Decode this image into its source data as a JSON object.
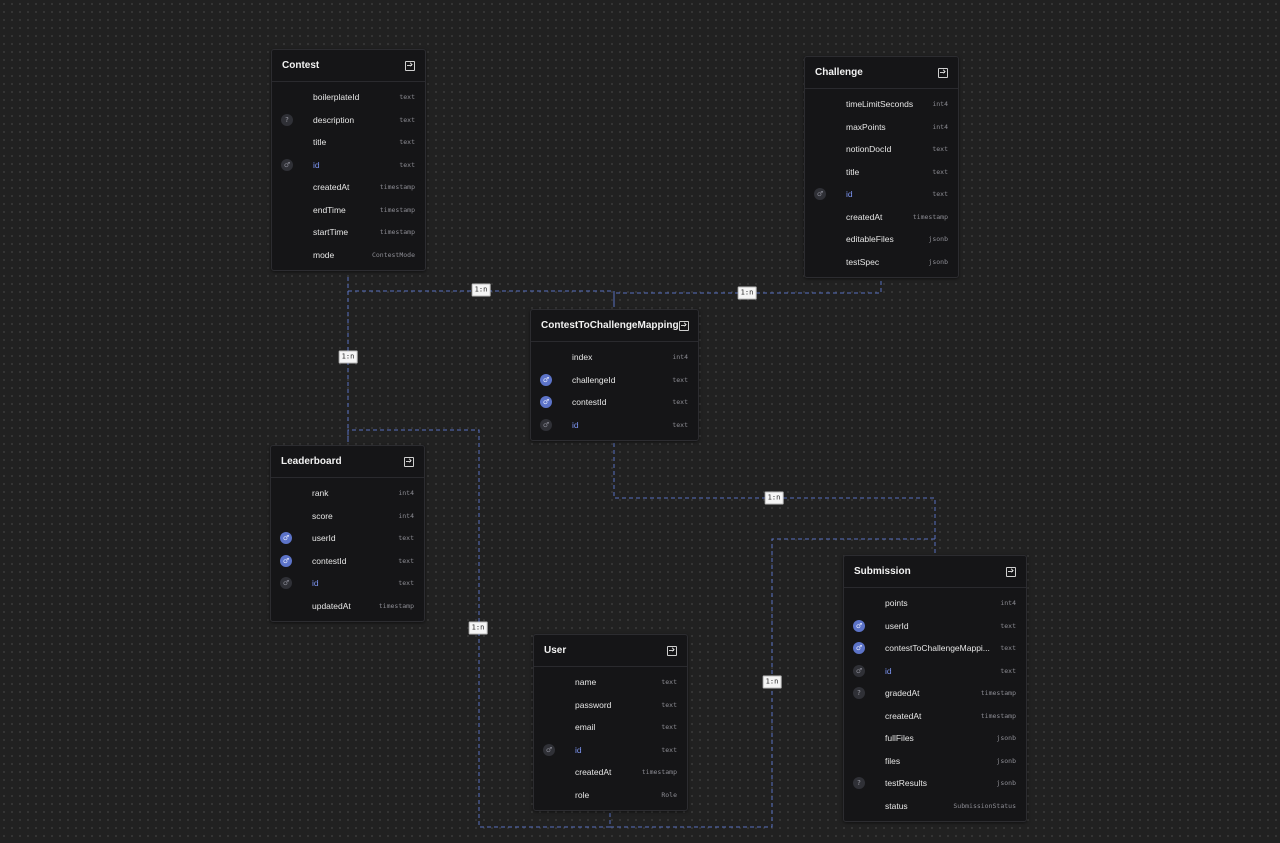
{
  "canvas": {
    "background": "#212121",
    "grid": "dotted"
  },
  "colors": {
    "edge": "#5670c0",
    "fk_badge": "#5c73c8",
    "pk_text": "#7b93f0"
  },
  "tables": [
    {
      "name": "Contest",
      "columns": [
        {
          "name": "boilerplateId",
          "type": "text",
          "badge": "none"
        },
        {
          "name": "description",
          "type": "text",
          "badge": "nullable"
        },
        {
          "name": "title",
          "type": "text",
          "badge": "none"
        },
        {
          "name": "id",
          "type": "text",
          "badge": "pk"
        },
        {
          "name": "createdAt",
          "type": "timestamp",
          "badge": "none"
        },
        {
          "name": "endTime",
          "type": "timestamp",
          "badge": "none"
        },
        {
          "name": "startTime",
          "type": "timestamp",
          "badge": "none"
        },
        {
          "name": "mode",
          "type": "ContestMode",
          "badge": "none"
        }
      ]
    },
    {
      "name": "Challenge",
      "columns": [
        {
          "name": "timeLimitSeconds",
          "type": "int4",
          "badge": "none"
        },
        {
          "name": "maxPoints",
          "type": "int4",
          "badge": "none"
        },
        {
          "name": "notionDocId",
          "type": "text",
          "badge": "none"
        },
        {
          "name": "title",
          "type": "text",
          "badge": "none"
        },
        {
          "name": "id",
          "type": "text",
          "badge": "pk"
        },
        {
          "name": "createdAt",
          "type": "timestamp",
          "badge": "none"
        },
        {
          "name": "editableFiles",
          "type": "jsonb",
          "badge": "none"
        },
        {
          "name": "testSpec",
          "type": "jsonb",
          "badge": "none"
        }
      ]
    },
    {
      "name": "ContestToChallengeMapping",
      "columns": [
        {
          "name": "index",
          "type": "int4",
          "badge": "none"
        },
        {
          "name": "challengeId",
          "type": "text",
          "badge": "fk"
        },
        {
          "name": "contestId",
          "type": "text",
          "badge": "fk"
        },
        {
          "name": "id",
          "type": "text",
          "badge": "pk"
        }
      ]
    },
    {
      "name": "Leaderboard",
      "columns": [
        {
          "name": "rank",
          "type": "int4",
          "badge": "none"
        },
        {
          "name": "score",
          "type": "int4",
          "badge": "none"
        },
        {
          "name": "userId",
          "type": "text",
          "badge": "fk"
        },
        {
          "name": "contestId",
          "type": "text",
          "badge": "fk"
        },
        {
          "name": "id",
          "type": "text",
          "badge": "pk"
        },
        {
          "name": "updatedAt",
          "type": "timestamp",
          "badge": "none"
        }
      ]
    },
    {
      "name": "User",
      "columns": [
        {
          "name": "name",
          "type": "text",
          "badge": "none"
        },
        {
          "name": "password",
          "type": "text",
          "badge": "none"
        },
        {
          "name": "email",
          "type": "text",
          "badge": "none"
        },
        {
          "name": "id",
          "type": "text",
          "badge": "pk"
        },
        {
          "name": "createdAt",
          "type": "timestamp",
          "badge": "none"
        },
        {
          "name": "role",
          "type": "Role",
          "badge": "none"
        }
      ]
    },
    {
      "name": "Submission",
      "columns": [
        {
          "name": "points",
          "type": "int4",
          "badge": "none"
        },
        {
          "name": "userId",
          "type": "text",
          "badge": "fk"
        },
        {
          "name": "contestToChallengeMappi...",
          "type": "text",
          "badge": "fk"
        },
        {
          "name": "id",
          "type": "text",
          "badge": "pk"
        },
        {
          "name": "gradedAt",
          "type": "timestamp",
          "badge": "nullable"
        },
        {
          "name": "createdAt",
          "type": "timestamp",
          "badge": "none"
        },
        {
          "name": "fullFiles",
          "type": "jsonb",
          "badge": "none"
        },
        {
          "name": "files",
          "type": "jsonb",
          "badge": "none"
        },
        {
          "name": "testResults",
          "type": "jsonb",
          "badge": "nullable"
        },
        {
          "name": "status",
          "type": "SubmissionStatus",
          "badge": "none"
        }
      ]
    }
  ],
  "relations": [
    {
      "from": "Contest",
      "to": "ContestToChallengeMapping",
      "label": "1:n"
    },
    {
      "from": "Challenge",
      "to": "ContestToChallengeMapping",
      "label": "1:n"
    },
    {
      "from": "Contest",
      "to": "Leaderboard",
      "label": "1:n"
    },
    {
      "from": "User",
      "to": "Leaderboard",
      "label": "1:n"
    },
    {
      "from": "ContestToChallengeMapping",
      "to": "Submission",
      "label": "1:n"
    },
    {
      "from": "User",
      "to": "Submission",
      "label": "1:n"
    }
  ]
}
